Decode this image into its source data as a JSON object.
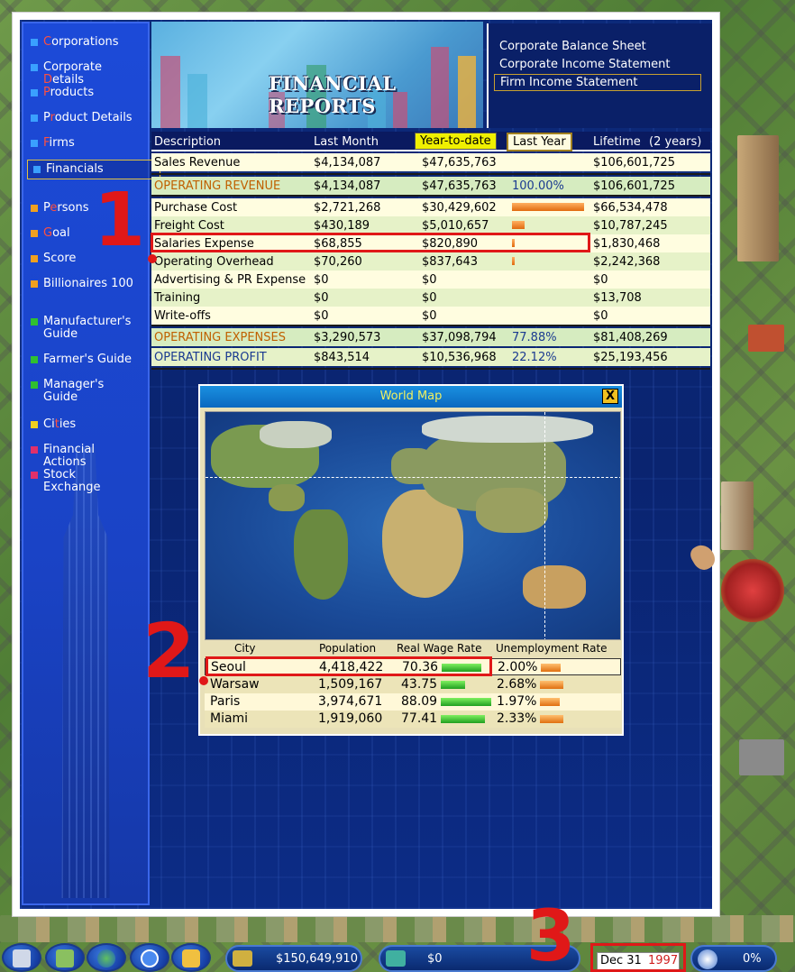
{
  "sidebar": {
    "items": [
      {
        "first": "C",
        "rest": "orporations",
        "color": "#3aa0ff"
      },
      {
        "first": "Corporate ",
        "hl": "D",
        "rest": "etails",
        "color": "#3aa0ff"
      },
      {
        "first": "P",
        "rest": "roducts",
        "color": "#3aa0ff"
      },
      {
        "first": "P",
        "hl": "r",
        "rest": "oduct Details",
        "color": "#3aa0ff"
      },
      {
        "first": "F",
        "rest": "irms",
        "color": "#3aa0ff"
      },
      {
        "first": "Financials",
        "rest": "",
        "color": "#3aa0ff"
      },
      {
        "first": "P",
        "hl": "e",
        "rest": "rsons",
        "color": "#f0a020"
      },
      {
        "first": "G",
        "rest": "oal",
        "color": "#f0a020"
      },
      {
        "first": "Score",
        "rest": "",
        "color": "#f0a020"
      },
      {
        "first": "Billionaires 100",
        "rest": "",
        "color": "#f0a020"
      },
      {
        "first": "Manufacturer's Guide",
        "rest": "",
        "color": "#30c030"
      },
      {
        "first": "Farmer's Guide",
        "rest": "",
        "color": "#30c030"
      },
      {
        "first": "Manager's Guide",
        "rest": "",
        "color": "#30c030"
      },
      {
        "first": "Ci",
        "hl": "t",
        "rest": "ies",
        "color": "#f0d020"
      },
      {
        "first": "Financial Actions",
        "rest": "",
        "color": "#e0306a"
      },
      {
        "first": "Stock Exchange",
        "rest": "",
        "color": "#e0306a"
      }
    ]
  },
  "banner": {
    "title": "FINANCIAL REPORTS"
  },
  "reports": {
    "links": [
      "Corporate Balance Sheet",
      "Corporate Income Statement",
      "Firm Income Statement"
    ]
  },
  "table": {
    "headers": {
      "description": "Description",
      "last_month": "Last Month",
      "ytd": "Year-to-date",
      "last_year": "Last Year",
      "lifetime": "Lifetime",
      "lifetime_note": "(2 years)"
    },
    "rows": [
      {
        "desc": "Sales Revenue",
        "lm": "$4,134,087",
        "ytd": "$47,635,763",
        "pct": "",
        "bar": 0,
        "life": "$106,601,725"
      },
      {
        "desc": "OPERATING REVENUE",
        "lm": "$4,134,087",
        "ytd": "$47,635,763",
        "pct": "100.00%",
        "bar": 0,
        "life": "$106,601,725"
      },
      {
        "desc": "Purchase Cost",
        "lm": "$2,721,268",
        "ytd": "$30,429,602",
        "pct": "",
        "bar": 1.0,
        "life": "$66,534,478"
      },
      {
        "desc": "Freight Cost",
        "lm": "$430,189",
        "ytd": "$5,010,657",
        "pct": "",
        "bar": 0.18,
        "life": "$10,787,245"
      },
      {
        "desc": "Salaries Expense",
        "lm": "$68,855",
        "ytd": "$820,890",
        "pct": "",
        "bar": 0.03,
        "life": "$1,830,468"
      },
      {
        "desc": "Operating Overhead",
        "lm": "$70,260",
        "ytd": "$837,643",
        "pct": "",
        "bar": 0.03,
        "life": "$2,242,368"
      },
      {
        "desc": "Advertising & PR Expense",
        "lm": "$0",
        "ytd": "$0",
        "pct": "",
        "bar": 0,
        "life": "$0"
      },
      {
        "desc": "Training",
        "lm": "$0",
        "ytd": "$0",
        "pct": "",
        "bar": 0,
        "life": "$13,708"
      },
      {
        "desc": "Write-offs",
        "lm": "$0",
        "ytd": "$0",
        "pct": "",
        "bar": 0,
        "life": "$0"
      },
      {
        "desc": "OPERATING EXPENSES",
        "lm": "$3,290,573",
        "ytd": "$37,098,794",
        "pct": "77.88%",
        "bar": 0,
        "life": "$81,408,269"
      },
      {
        "desc": "OPERATING PROFIT",
        "lm": "$843,514",
        "ytd": "$10,536,968",
        "pct": "22.12%",
        "bar": 0,
        "life": "$25,193,456"
      }
    ]
  },
  "annotations": {
    "one": "1",
    "two": "2",
    "three": "3"
  },
  "worldmap": {
    "title": "World Map",
    "close": "X",
    "headers": {
      "city": "City",
      "population": "Population",
      "wage": "Real Wage Rate",
      "unemp": "Unemployment Rate"
    },
    "cities": [
      {
        "city": "Seoul",
        "pop": "4,418,422",
        "wage": "70.36",
        "wage_level": 0.79,
        "unemp": "2.00%",
        "unemp_level": 0.85
      },
      {
        "city": "Warsaw",
        "pop": "1,509,167",
        "wage": "43.75",
        "wage_level": 0.49,
        "unemp": "2.68%",
        "unemp_level": 1.0
      },
      {
        "city": "Paris",
        "pop": "3,974,671",
        "wage": "88.09",
        "wage_level": 1.0,
        "unemp": "1.97%",
        "unemp_level": 0.85
      },
      {
        "city": "Miami",
        "pop": "1,919,060",
        "wage": "77.41",
        "wage_level": 0.88,
        "unemp": "2.33%",
        "unemp_level": 1.0
      }
    ]
  },
  "statusbar": {
    "cash": "$150,649,910",
    "transactions": "$0",
    "date_day": "Dec 31",
    "date_year": "1997",
    "speed": "0%"
  }
}
